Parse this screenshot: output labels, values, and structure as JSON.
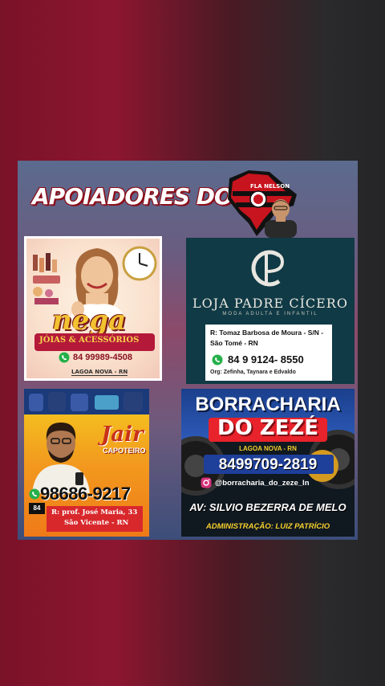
{
  "headline": "APOIADORES DO",
  "badge_text": "FLA NELSON",
  "panel1": {
    "brand": "nega",
    "tagline": "JÓIAS & ACESSÓRIOS",
    "phone": "84 99989-4508",
    "city": "LAGOA NOVA - RN"
  },
  "panel2": {
    "brand": "LOJA PADRE CÍCERO",
    "subtitle": "MODA ADULTA E INFANTIL",
    "address": "R: Tomaz Barbosa de Moura - S/N - São Tomé - RN",
    "phone": "84 9 9124- 8550",
    "org": "Org: Zefinha, Taynara e Edvaldo"
  },
  "panel3": {
    "brand": "Jair",
    "role": "CAPOTEIRO",
    "phone": "98686-9217",
    "ddd": "84",
    "address_line1": "R: prof. José Maria, 33",
    "address_line2": "São Vicente - RN"
  },
  "panel4": {
    "brand_line1": "BORRACHARIA",
    "brand_line2": "DO ZEZÉ",
    "city": "LAGOA NOVA - RN",
    "phone": "8499709-2819",
    "instagram": "@borracharia_do_zeze_ln",
    "address": "AV: SILVIO BEZERRA DE MELO",
    "admin": "ADMINISTRAÇÃO: LUIZ PATRÍCIO"
  }
}
